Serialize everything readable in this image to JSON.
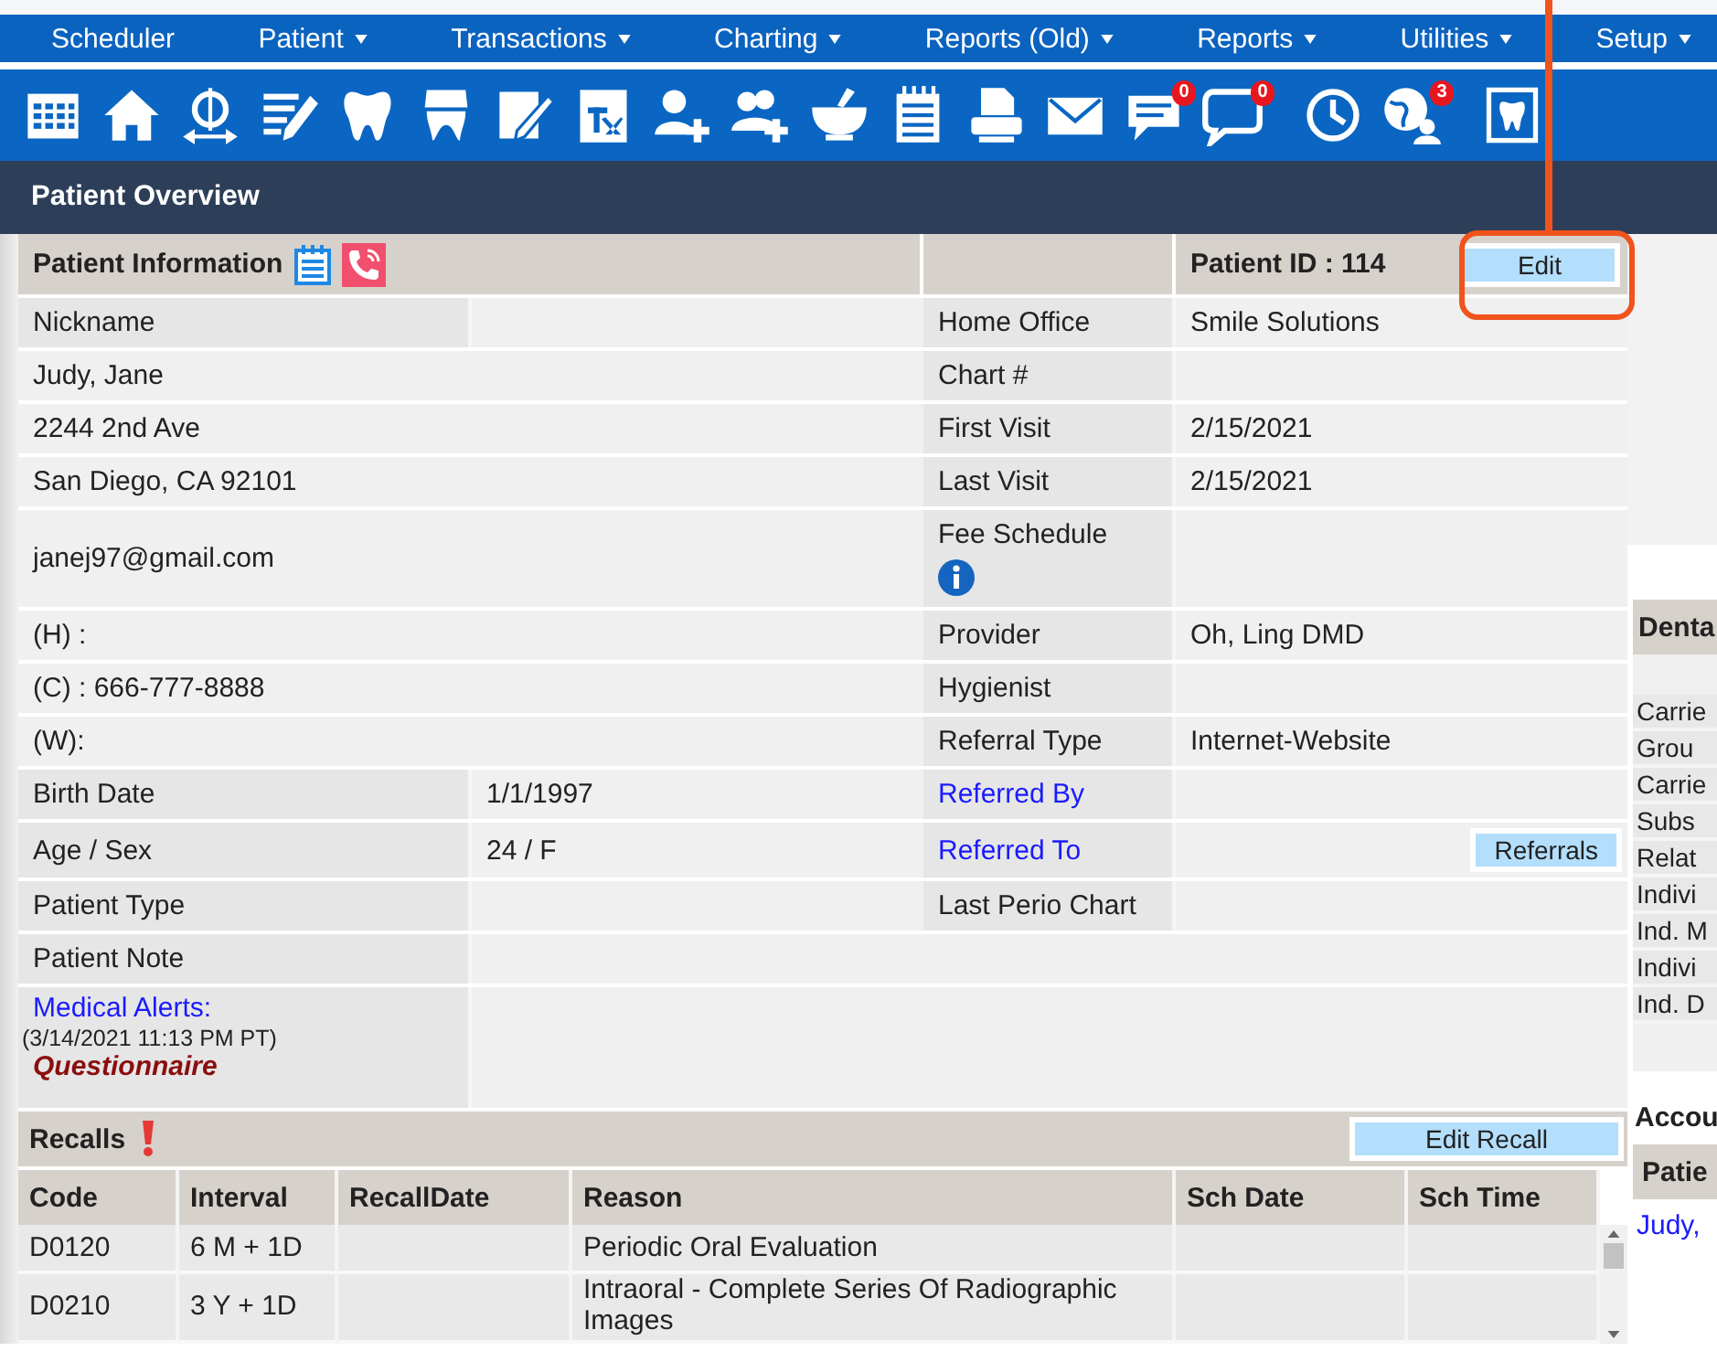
{
  "menu": [
    {
      "label": "Scheduler",
      "has_menu": false
    },
    {
      "label": "Patient",
      "has_menu": true
    },
    {
      "label": "Transactions",
      "has_menu": true
    },
    {
      "label": "Charting",
      "has_menu": true
    },
    {
      "label": "Reports (Old)",
      "has_menu": true
    },
    {
      "label": "Reports",
      "has_menu": true
    },
    {
      "label": "Utilities",
      "has_menu": true
    },
    {
      "label": "Setup",
      "has_menu": true
    }
  ],
  "toolbar_badges": [
    "0",
    "0",
    "3"
  ],
  "page_title": "Patient Overview",
  "patient_info": {
    "title": "Patient Information",
    "patient_id": "Patient ID : 114",
    "edit_button": "Edit"
  },
  "info_rows": [
    {
      "left": {
        "kind": "field",
        "label": "Nickname"
      },
      "right": {
        "kind": "field",
        "label": "Home Office",
        "value": "Smile Solutions"
      }
    },
    {
      "left": {
        "kind": "line",
        "text": "Judy, Jane"
      },
      "right": {
        "kind": "field",
        "label": "Chart #"
      }
    },
    {
      "left": {
        "kind": "line",
        "text": "2244 2nd Ave"
      },
      "right": {
        "kind": "field",
        "label": "First Visit",
        "value": "2/15/2021"
      }
    },
    {
      "left": {
        "kind": "line",
        "text": "San Diego, CA 92101"
      },
      "right": {
        "kind": "field",
        "label": "Last Visit",
        "value": "2/15/2021"
      }
    },
    {
      "left": {
        "kind": "line",
        "text": "janej97@gmail.com"
      },
      "right": {
        "kind": "info",
        "label": "Fee Schedule"
      }
    },
    {
      "left": {
        "kind": "line",
        "text": "(H) :"
      },
      "right": {
        "kind": "field",
        "label": "Provider",
        "value": "Oh, Ling DMD"
      }
    },
    {
      "left": {
        "kind": "line",
        "text": "(C) : 666-777-8888"
      },
      "right": {
        "kind": "field",
        "label": "Hygienist"
      }
    },
    {
      "left": {
        "kind": "line",
        "text": "(W):"
      },
      "right": {
        "kind": "field",
        "label": "Referral Type",
        "value": "Internet-Website"
      }
    },
    {
      "left": {
        "kind": "field",
        "label": "Birth Date",
        "value": "1/1/1997"
      },
      "right": {
        "kind": "link",
        "label": "Referred By"
      }
    },
    {
      "left": {
        "kind": "field",
        "label": "Age / Sex",
        "value": "24 / F"
      },
      "right": {
        "kind": "link",
        "label": "Referred To",
        "button": "Referrals"
      }
    },
    {
      "left": {
        "kind": "field",
        "label": "Patient Type"
      },
      "right": {
        "kind": "field",
        "label": "Last Perio Chart"
      }
    },
    {
      "left": {
        "kind": "field",
        "label": "Patient Note"
      }
    },
    {
      "left": {
        "kind": "alerts",
        "title": "Medical Alerts:",
        "time": "(3/14/2021 11:13 PM PT)",
        "link": "Questionnaire"
      }
    }
  ],
  "recalls": {
    "title": "Recalls",
    "edit_button": "Edit Recall",
    "columns": [
      "Code",
      "Interval",
      "RecallDate",
      "Reason",
      "Sch Date",
      "Sch Time"
    ],
    "rows": [
      [
        "D0120",
        "6 M + 1D",
        "",
        "Periodic Oral Evaluation",
        "",
        ""
      ],
      [
        "D0210",
        "3 Y + 1D",
        "",
        "Intraoral - Complete Series Of Radiographic Images",
        "",
        ""
      ]
    ]
  },
  "side_panel": {
    "title": "Denta",
    "lines": [
      "Carrie",
      "Grou",
      "Carrie",
      "Subs",
      "Relat",
      "Indivi",
      "Ind. M",
      "Indivi",
      "Ind. D"
    ]
  },
  "account_panel": {
    "title": "Accou",
    "column": "Patie",
    "link": "Judy,"
  }
}
